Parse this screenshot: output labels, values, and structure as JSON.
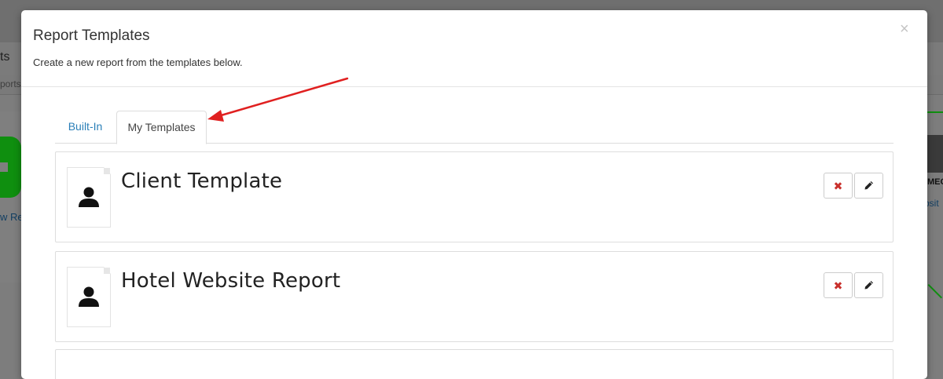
{
  "background": {
    "nav_fragment": "ts",
    "crumb_fragment": "ports",
    "left_link_fragment": "w Re",
    "right_label_fragment": "MEC",
    "right_link_fragment": "bsit"
  },
  "modal": {
    "title": "Report Templates",
    "subtitle": "Create a new report from the templates below.",
    "close_label": "×"
  },
  "tabs": [
    {
      "label": "Built-In",
      "active": false
    },
    {
      "label": "My Templates",
      "active": true
    }
  ],
  "templates": [
    {
      "title": "Client Template"
    },
    {
      "title": "Hotel Website Report"
    }
  ],
  "icons": {
    "delete": "delete-x-icon",
    "edit": "pencil-icon",
    "thumbnail": "person-icon"
  },
  "colors": {
    "link_blue": "#2a7fb8",
    "delete_red": "#c9302c",
    "annotation_red": "#e02020"
  }
}
